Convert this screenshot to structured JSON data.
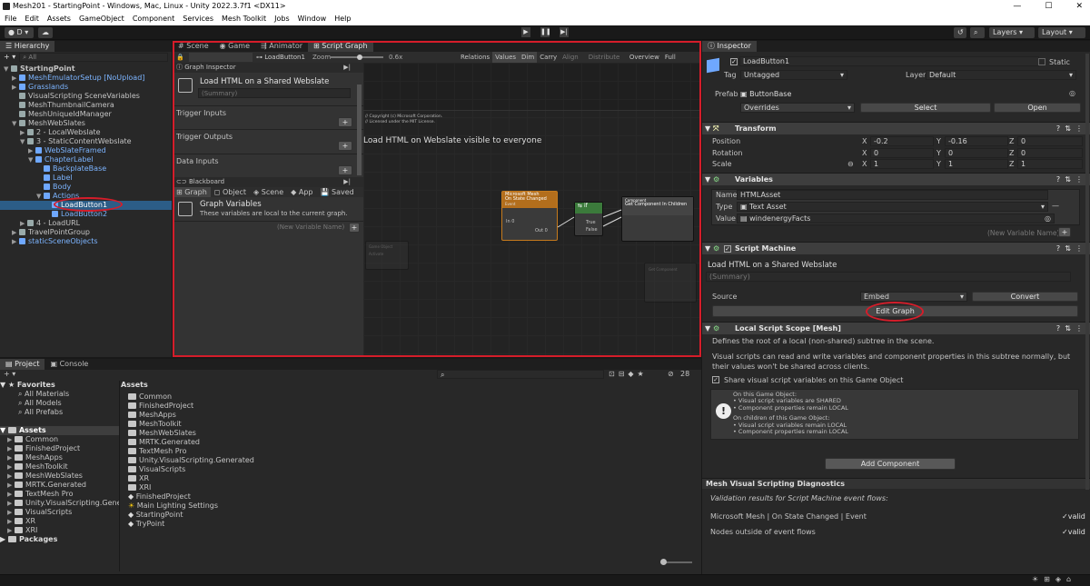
{
  "window": {
    "title": "Mesh201 - StartingPoint - Windows, Mac, Linux - Unity 2022.3.7f1 <DX11>"
  },
  "menu": [
    "File",
    "Edit",
    "Assets",
    "GameObject",
    "Component",
    "Services",
    "Mesh Toolkit",
    "Jobs",
    "Window",
    "Help"
  ],
  "toolbar": {
    "account": "D",
    "layers": "Layers",
    "layout": "Layout"
  },
  "hierarchy": {
    "tab": "Hierarchy",
    "search_placeholder": "All",
    "items": [
      {
        "label": "StartingPoint",
        "depth": 0,
        "arrow": "▼",
        "kind": "scene"
      },
      {
        "label": "MeshEmulatorSetup [NoUpload]",
        "depth": 1,
        "arrow": "▶",
        "kind": "prefab"
      },
      {
        "label": "Grasslands",
        "depth": 1,
        "arrow": "▶",
        "kind": "prefab"
      },
      {
        "label": "VisualScripting SceneVariables",
        "depth": 1,
        "arrow": "",
        "kind": "obj"
      },
      {
        "label": "MeshThumbnailCamera",
        "depth": 1,
        "arrow": "",
        "kind": "obj"
      },
      {
        "label": "MeshUniqueIdManager",
        "depth": 1,
        "arrow": "",
        "kind": "obj"
      },
      {
        "label": "MeshWebSlates",
        "depth": 1,
        "arrow": "▼",
        "kind": "obj"
      },
      {
        "label": "2 - LocalWebslate",
        "depth": 2,
        "arrow": "▶",
        "kind": "obj"
      },
      {
        "label": "3 - StaticContentWebslate",
        "depth": 2,
        "arrow": "▼",
        "kind": "obj"
      },
      {
        "label": "WebSlateFramed",
        "depth": 3,
        "arrow": "▶",
        "kind": "prefab"
      },
      {
        "label": "ChapterLabel",
        "depth": 3,
        "arrow": "▼",
        "kind": "prefab"
      },
      {
        "label": "BackplateBase",
        "depth": 4,
        "arrow": "",
        "kind": "prefab"
      },
      {
        "label": "Label",
        "depth": 4,
        "arrow": "",
        "kind": "prefab"
      },
      {
        "label": "Body",
        "depth": 4,
        "arrow": "",
        "kind": "prefab"
      },
      {
        "label": "Actions",
        "depth": 4,
        "arrow": "▼",
        "kind": "prefab"
      },
      {
        "label": "LoadButton1",
        "depth": 5,
        "arrow": "",
        "kind": "prefab",
        "selected": true
      },
      {
        "label": "LoadButton2",
        "depth": 5,
        "arrow": "",
        "kind": "prefab"
      },
      {
        "label": "4 - LoadURL",
        "depth": 2,
        "arrow": "▶",
        "kind": "obj"
      },
      {
        "label": "TravelPointGroup",
        "depth": 1,
        "arrow": "▶",
        "kind": "obj"
      },
      {
        "label": "staticSceneObjects",
        "depth": 1,
        "arrow": "▶",
        "kind": "prefab"
      }
    ]
  },
  "center": {
    "tabs": [
      "Scene",
      "Game",
      "Animator",
      "Script Graph"
    ],
    "breadcrumb": "LoadButton1",
    "zoom_label": "Zoom",
    "zoom_value": "0.6x",
    "graph_toolbar": [
      "Relations",
      "Values",
      "Dim",
      "Carry",
      "Align ▾",
      "Distribute ▾",
      "Overview",
      "Full Screen"
    ],
    "graph_inspector": {
      "title": "Graph Inspector",
      "graph_name": "Load HTML on a Shared Webslate",
      "summary_placeholder": "(Summary)",
      "sections": [
        "Trigger Inputs",
        "Trigger Outputs",
        "Data Inputs"
      ]
    },
    "blackboard": {
      "title": "Blackboard",
      "tabs": [
        "Graph",
        "Object",
        "Scene",
        "App",
        "Saved"
      ],
      "heading": "Graph Variables",
      "desc": "These variables are local to the current graph.",
      "new_var_placeholder": "(New Variable Name)"
    },
    "canvas": {
      "copyright1": "// Copyright (c) Microsoft Corporation.",
      "copyright2": "// Licensed under the MIT License.",
      "group_label": "Load HTML on Webslate visible to everyone",
      "node1_title": "Microsoft Mesh",
      "node1_sub": "On State Changed",
      "node1_event": "Event",
      "node1_port_in": "In 0",
      "node1_port_out": "Out 0",
      "node2_title": "if",
      "node2_true": "True",
      "node2_false": "False",
      "node3_title": "Component",
      "node3_sub": "Get Component In Children",
      "ghost1": "Game Object",
      "ghost1_sub": "Activate",
      "ghost2": "Get Component"
    }
  },
  "inspector": {
    "tab": "Inspector",
    "object_name": "LoadButton1",
    "static_label": "Static",
    "tag_label": "Tag",
    "tag_value": "Untagged",
    "layer_label": "Layer",
    "layer_value": "Default",
    "prefab_label": "Prefab",
    "prefab_value": "ButtonBase",
    "overrides": "Overrides",
    "select": "Select",
    "open": "Open",
    "transform": {
      "title": "Transform",
      "rows": [
        {
          "label": "Position",
          "x": "-0.2",
          "y": "-0.16",
          "z": "0"
        },
        {
          "label": "Rotation",
          "x": "0",
          "y": "0",
          "z": "0"
        },
        {
          "label": "Scale",
          "x": "1",
          "y": "1",
          "z": "1"
        }
      ]
    },
    "variables": {
      "title": "Variables",
      "name_label": "Name",
      "name_value": "HTMLAsset",
      "type_label": "Type",
      "type_value": "Text Asset",
      "value_label": "Value",
      "value_value": "windenergyFacts",
      "new_var_placeholder": "(New Variable Name)"
    },
    "script_machine": {
      "title": "Script Machine",
      "title_field": "Load HTML on a Shared Webslate",
      "summary_placeholder": "(Summary)",
      "source_label": "Source",
      "source_value": "Embed",
      "convert": "Convert",
      "edit_graph": "Edit Graph"
    },
    "local_scope": {
      "title": "Local Script Scope [Mesh]",
      "desc1": "Defines the root of a local (non-shared) subtree in the scene.",
      "desc2": "Visual scripts can read and write variables and component properties in this subtree normally, but their values won't be shared across clients.",
      "share_label": "Share visual script variables on this Game Object",
      "info": [
        "On this Game Object:",
        "• Visual script variables are SHARED",
        "• Component properties remain LOCAL",
        "",
        "On children of this Game Object:",
        "• Visual script variables remain LOCAL",
        "• Component properties remain LOCAL"
      ]
    },
    "add_component": "Add Component",
    "diagnostics": {
      "title": "Mesh Visual Scripting Diagnostics",
      "subtitle": "Validation results for Script Machine event flows:",
      "row1": "Microsoft Mesh | On State Changed | Event",
      "row2": "Nodes outside of event flows",
      "valid": "valid"
    }
  },
  "project": {
    "tabs": [
      "Project",
      "Console"
    ],
    "count": "28",
    "favorites_label": "Favorites",
    "favorites": [
      "All Materials",
      "All Models",
      "All Prefabs"
    ],
    "assets_label": "Assets",
    "tree": [
      "Common",
      "FinishedProject",
      "MeshApps",
      "MeshToolkit",
      "MeshWebSlates",
      "MRTK.Generated",
      "TextMesh Pro",
      "Unity.VisualScripting.Generated",
      "VisualScripts",
      "XR",
      "XRI"
    ],
    "packages_label": "Packages",
    "breadcrumb": "Assets",
    "files": [
      {
        "name": "Common",
        "kind": "folder"
      },
      {
        "name": "FinishedProject",
        "kind": "folder"
      },
      {
        "name": "MeshApps",
        "kind": "folder"
      },
      {
        "name": "MeshToolkit",
        "kind": "folder"
      },
      {
        "name": "MeshWebSlates",
        "kind": "folder"
      },
      {
        "name": "MRTK.Generated",
        "kind": "folder"
      },
      {
        "name": "TextMesh Pro",
        "kind": "folder"
      },
      {
        "name": "Unity.VisualScripting.Generated",
        "kind": "folder"
      },
      {
        "name": "VisualScripts",
        "kind": "folder"
      },
      {
        "name": "XR",
        "kind": "folder"
      },
      {
        "name": "XRI",
        "kind": "folder"
      },
      {
        "name": "FinishedProject",
        "kind": "scene"
      },
      {
        "name": "Main Lighting Settings",
        "kind": "light"
      },
      {
        "name": "StartingPoint",
        "kind": "scene"
      },
      {
        "name": "TryPoint",
        "kind": "scene"
      }
    ]
  }
}
